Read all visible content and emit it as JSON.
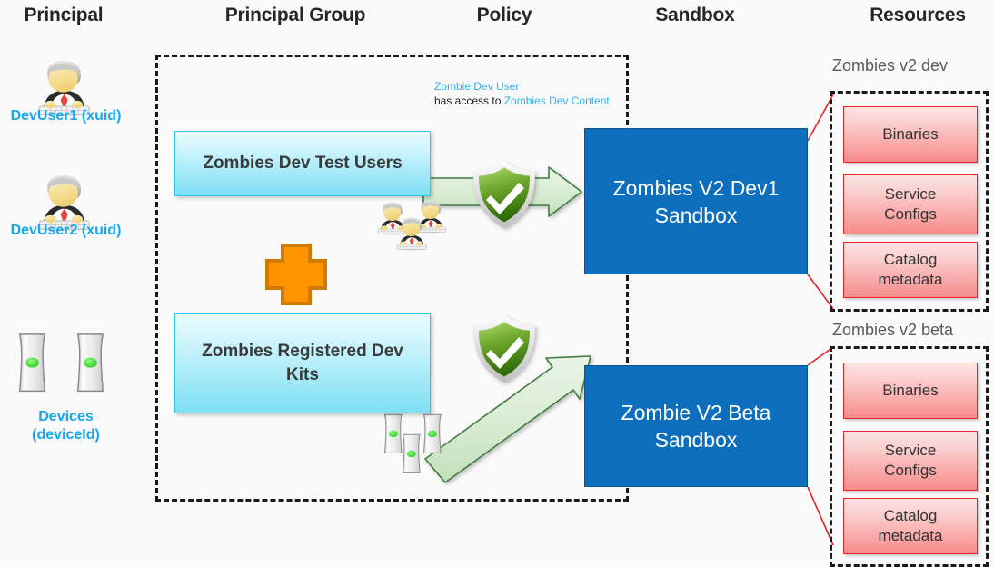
{
  "headers": [
    {
      "label": "Principal"
    },
    {
      "label": "Principal Group"
    },
    {
      "label": "Policy"
    },
    {
      "label": "Sandbox"
    },
    {
      "label": "Resources"
    }
  ],
  "principals": [
    {
      "label": "DevUser1 (xuid)",
      "icon": "user-at-computer-icon"
    },
    {
      "label": "DevUser2 (xuid)",
      "icon": "user-at-computer-icon"
    },
    {
      "label": "Devices\n(deviceId)",
      "label_line1": "Devices",
      "label_line2": "(deviceId)",
      "icon": "device-console-icon"
    }
  ],
  "principal_groups": [
    {
      "label": "Zombies Dev Test Users"
    },
    {
      "label": "Zombies Registered Dev Kits"
    }
  ],
  "operator": {
    "symbol": "+",
    "name": "plus-icon",
    "color": "#ff9300"
  },
  "policy": {
    "note_line1": "Zombie Dev User",
    "note_line2_prefix": "has access to ",
    "note_line2_link": "Zombies Dev Content",
    "shields": [
      {
        "name": "policy-shield-allow-dev-users",
        "state": "allow"
      },
      {
        "name": "policy-shield-allow-dev-kits",
        "state": "allow"
      }
    ]
  },
  "sandboxes": [
    {
      "label": "Zombies V2 Dev1 Sandbox",
      "line1": "Zombies V2 Dev1",
      "line2": "Sandbox"
    },
    {
      "label": "Zombie V2 Beta Sandbox",
      "line1": "Zombie V2 Beta",
      "line2": "Sandbox"
    }
  ],
  "resource_groups": [
    {
      "caption": "Zombies v2 dev",
      "items": [
        {
          "label": "Binaries"
        },
        {
          "label": "Service Configs",
          "line1": "Service",
          "line2": "Configs"
        },
        {
          "label": "Catalog metadata",
          "line1": "Catalog",
          "line2": "metadata"
        }
      ]
    },
    {
      "caption": "Zombies v2 beta",
      "items": [
        {
          "label": "Binaries"
        },
        {
          "label": "Service Configs",
          "line1": "Service",
          "line2": "Configs"
        },
        {
          "label": "Catalog metadata",
          "line1": "Catalog",
          "line2": "metadata"
        }
      ]
    }
  ],
  "colors": {
    "accent_blue": "#17a7ef",
    "sandbox_blue": "#0d6ebd",
    "group_cyan": "#2ec8ec",
    "resource_red": "#e8232a",
    "plus_orange": "#ff9300",
    "arrow_green": "#3f7d3f",
    "connector_red": "#e8232a",
    "header_text": "#262626"
  },
  "icons": {
    "group_users": "user-group-icon",
    "group_devices": "device-group-icon"
  }
}
